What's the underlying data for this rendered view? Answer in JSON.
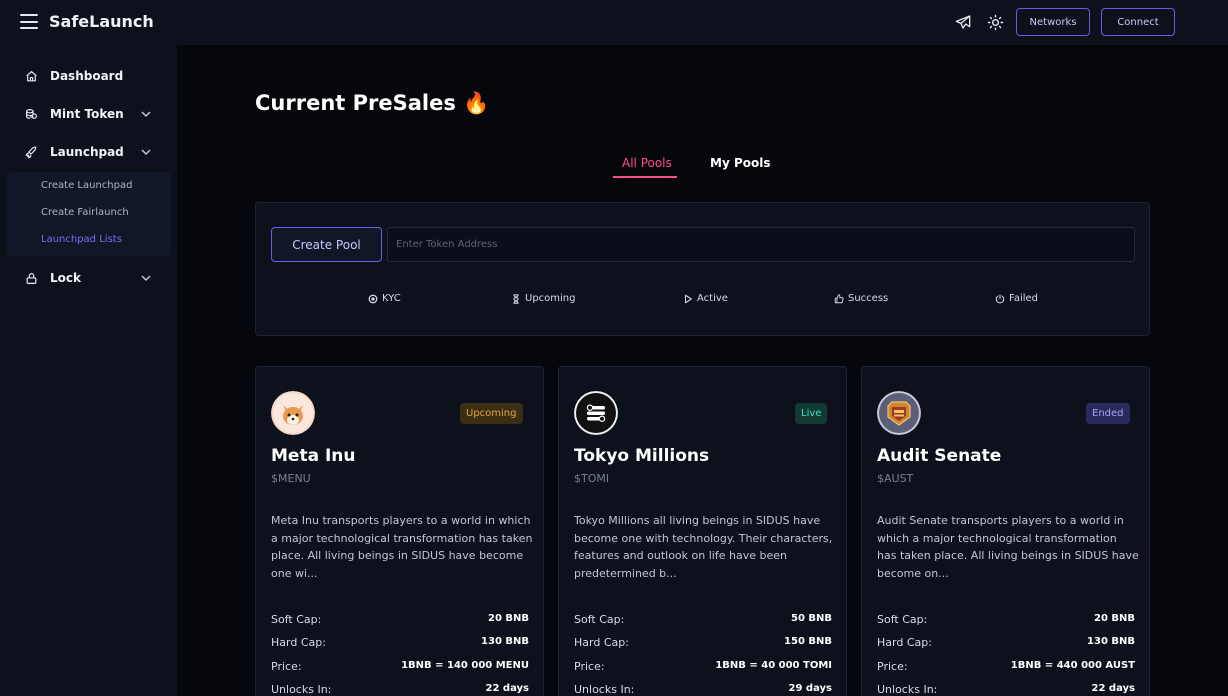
{
  "topbar": {
    "brand": "SafeLaunch",
    "networks_label": "Networks",
    "connect_label": "Connect"
  },
  "sidebar": {
    "items": [
      {
        "label": "Dashboard"
      },
      {
        "label": "Mint Token"
      },
      {
        "label": "Launchpad"
      },
      {
        "label": "Lock"
      }
    ],
    "launchpad_sub": [
      {
        "label": "Create Launchpad"
      },
      {
        "label": "Create Fairlaunch"
      },
      {
        "label": "Launchpad Lists"
      }
    ]
  },
  "main": {
    "title": "Current PreSales 🔥",
    "tabs": [
      {
        "label": "All Pools"
      },
      {
        "label": "My Pools"
      }
    ],
    "create_pool_label": "Create Pool",
    "search_placeholder": "Enter Token Address",
    "filters": [
      {
        "label": "KYC",
        "icon": "kyc-icon"
      },
      {
        "label": "Upcoming",
        "icon": "hourglass-icon"
      },
      {
        "label": "Active",
        "icon": "play-icon"
      },
      {
        "label": "Success",
        "icon": "thumbs-up-icon"
      },
      {
        "label": "Failed",
        "icon": "power-icon"
      }
    ]
  },
  "cards": [
    {
      "status": "Upcoming",
      "name": "Meta Inu",
      "symbol": "$MENU",
      "description": "Meta Inu transports players to a world in which a major technological transformation has taken place. All living beings in SIDUS have become one wi...",
      "soft_cap_label": "Soft Cap:",
      "soft_cap": "20 BNB",
      "hard_cap_label": "Hard Cap:",
      "hard_cap": "130 BNB",
      "price_label": "Price:",
      "price": "1BNB = 140 000 MENU",
      "unlocks_label": "Unlocks In:",
      "unlocks": "22 days"
    },
    {
      "status": "Live",
      "name": "Tokyo Millions",
      "symbol": "$TOMI",
      "description": "Tokyo Millions all living beings in SIDUS have become one with technology. Their characters, features and outlook on life have been predetermined b...",
      "soft_cap_label": "Soft Cap:",
      "soft_cap": "50 BNB",
      "hard_cap_label": "Hard Cap:",
      "hard_cap": "150 BNB",
      "price_label": "Price:",
      "price": "1BNB = 40 000 TOMI",
      "unlocks_label": "Unlocks In:",
      "unlocks": "29 days"
    },
    {
      "status": "Ended",
      "name": "Audit Senate",
      "symbol": "$AUST",
      "description": "Audit Senate transports players to a world in which a major technological transformation has taken place. All living beings in SIDUS have become on...",
      "soft_cap_label": "Soft Cap:",
      "soft_cap": "20 BNB",
      "hard_cap_label": "Hard Cap:",
      "hard_cap": "130 BNB",
      "price_label": "Price:",
      "price": "1BNB = 440 000 AUST",
      "unlocks_label": "Unlocks In:",
      "unlocks": "22 days"
    }
  ],
  "colors": {
    "accent": "#6c5ce7",
    "tab_active": "#ff4d8d",
    "background": "#05070d",
    "panel": "#0d111c"
  }
}
